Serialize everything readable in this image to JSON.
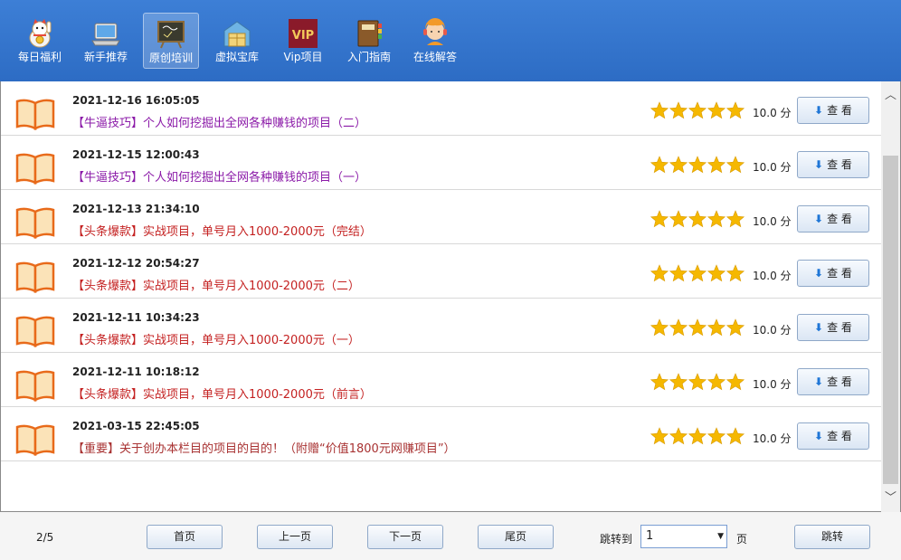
{
  "toolbar": {
    "items": [
      {
        "label": "每日福利",
        "icon": "lucky-cat-icon"
      },
      {
        "label": "新手推荐",
        "icon": "laptop-icon"
      },
      {
        "label": "原创培训",
        "icon": "blackboard-icon",
        "active": true
      },
      {
        "label": "虚拟宝库",
        "icon": "warehouse-icon"
      },
      {
        "label": "Vip项目",
        "icon": "vip-icon",
        "badge": "VIP"
      },
      {
        "label": "入门指南",
        "icon": "guide-book-icon"
      },
      {
        "label": "在线解答",
        "icon": "support-agent-icon"
      }
    ]
  },
  "list": {
    "items": [
      {
        "date": "2021-12-16 16:05:05",
        "title": "【牛逼技巧】个人如何挖掘出全网各种赚钱的项目（二）",
        "title_color": "#8b1aa8",
        "rating": 5,
        "score": "10.0 分",
        "view_label": "查 看"
      },
      {
        "date": "2021-12-15 12:00:43",
        "title": "【牛逼技巧】个人如何挖掘出全网各种赚钱的项目（一）",
        "title_color": "#8b1aa8",
        "rating": 5,
        "score": "10.0 分",
        "view_label": "查 看"
      },
      {
        "date": "2021-12-13 21:34:10",
        "title": "【头条爆款】实战项目，单号月入1000-2000元（完结）",
        "title_color": "#c42121",
        "rating": 5,
        "score": "10.0 分",
        "view_label": "查 看"
      },
      {
        "date": "2021-12-12 20:54:27",
        "title": "【头条爆款】实战项目，单号月入1000-2000元（二）",
        "title_color": "#c42121",
        "rating": 5,
        "score": "10.0 分",
        "view_label": "查 看"
      },
      {
        "date": "2021-12-11 10:34:23",
        "title": "【头条爆款】实战项目，单号月入1000-2000元（一）",
        "title_color": "#c42121",
        "rating": 5,
        "score": "10.0 分",
        "view_label": "查 看"
      },
      {
        "date": "2021-12-11 10:18:12",
        "title": "【头条爆款】实战项目，单号月入1000-2000元（前言）",
        "title_color": "#c42121",
        "rating": 5,
        "score": "10.0 分",
        "view_label": "查 看"
      },
      {
        "date": "2021-03-15 22:45:05",
        "title": "【重要】关于创办本栏目的项目的目的！（附赠“价值1800元网赚项目”）",
        "title_color": "#a83232",
        "rating": 5,
        "score": "10.0 分",
        "view_label": "查 看"
      }
    ]
  },
  "footer": {
    "page_info": "2/5",
    "first_label": "首页",
    "prev_label": "上一页",
    "next_label": "下一页",
    "last_label": "尾页",
    "jump_to_label": "跳转到",
    "jump_value": "1",
    "page_suffix": "页",
    "jump_button_label": "跳转"
  },
  "colors": {
    "toolbar_bg": "#3d7fd6",
    "star": "#f5b800",
    "view_arrow": "#1f76d6"
  }
}
